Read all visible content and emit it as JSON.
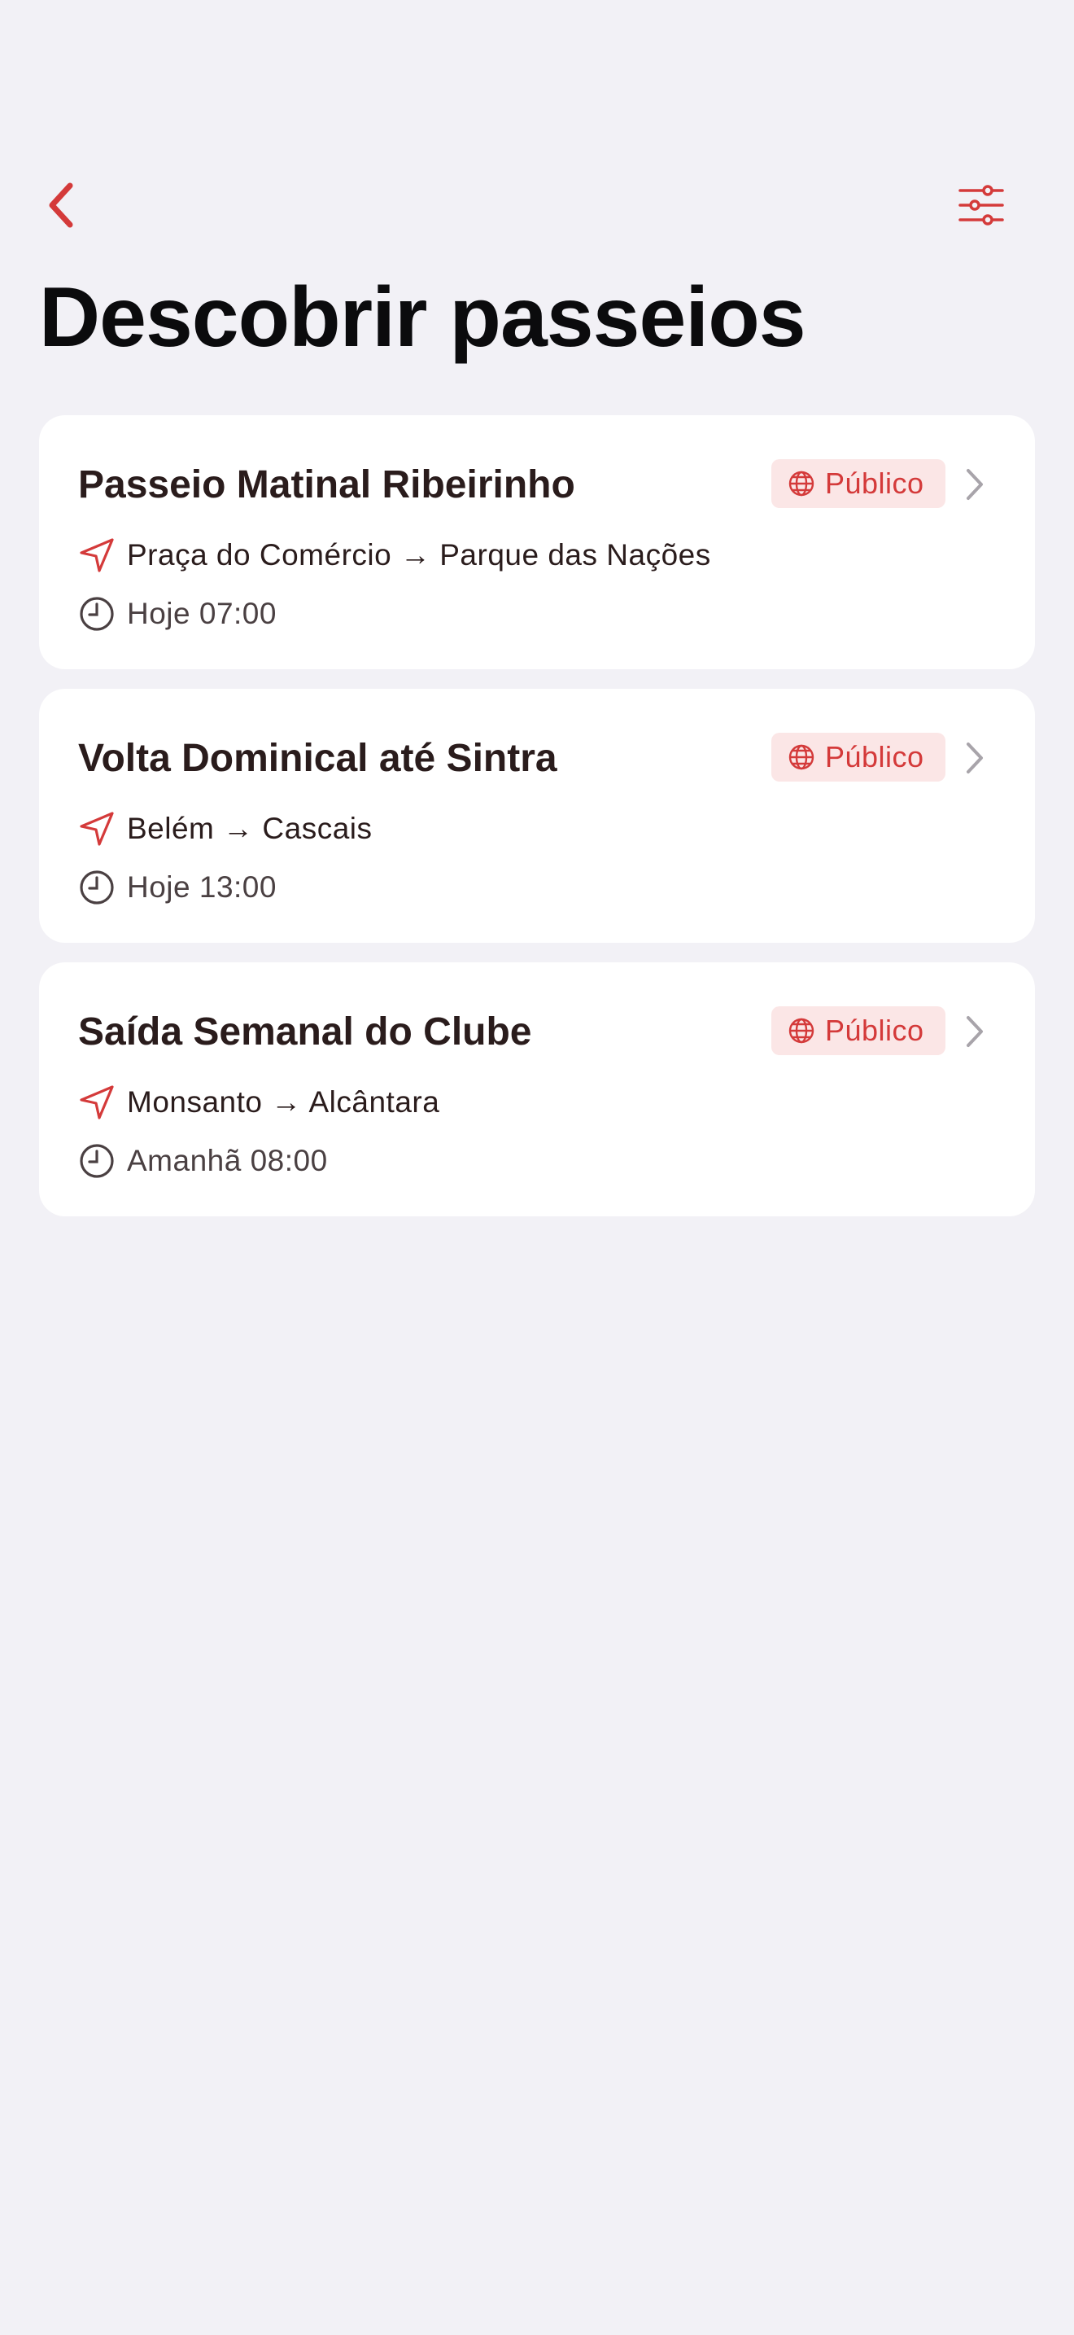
{
  "colors": {
    "background": "#f2f1f6",
    "card": "#ffffff",
    "accent": "#d43a3a",
    "badge_bg": "#fbe6e6",
    "title_text": "#2a1c1c",
    "secondary_text": "#4a4042"
  },
  "nav": {
    "back_icon": "chevron-left-icon",
    "filter_icon": "sliders-icon"
  },
  "page": {
    "title": "Descobrir passeios"
  },
  "rides": [
    {
      "title": "Passeio Matinal Ribeirinho",
      "visibility": "Público",
      "route": "Praça do Comércio → Parque das Nações",
      "time": "Hoje 07:00"
    },
    {
      "title": "Volta Dominical até Sintra",
      "visibility": "Público",
      "route": "Belém → Cascais",
      "time": "Hoje 13:00"
    },
    {
      "title": "Saída Semanal do Clube",
      "visibility": "Público",
      "route": "Monsanto → Alcântara",
      "time": "Amanhã 08:00"
    }
  ]
}
